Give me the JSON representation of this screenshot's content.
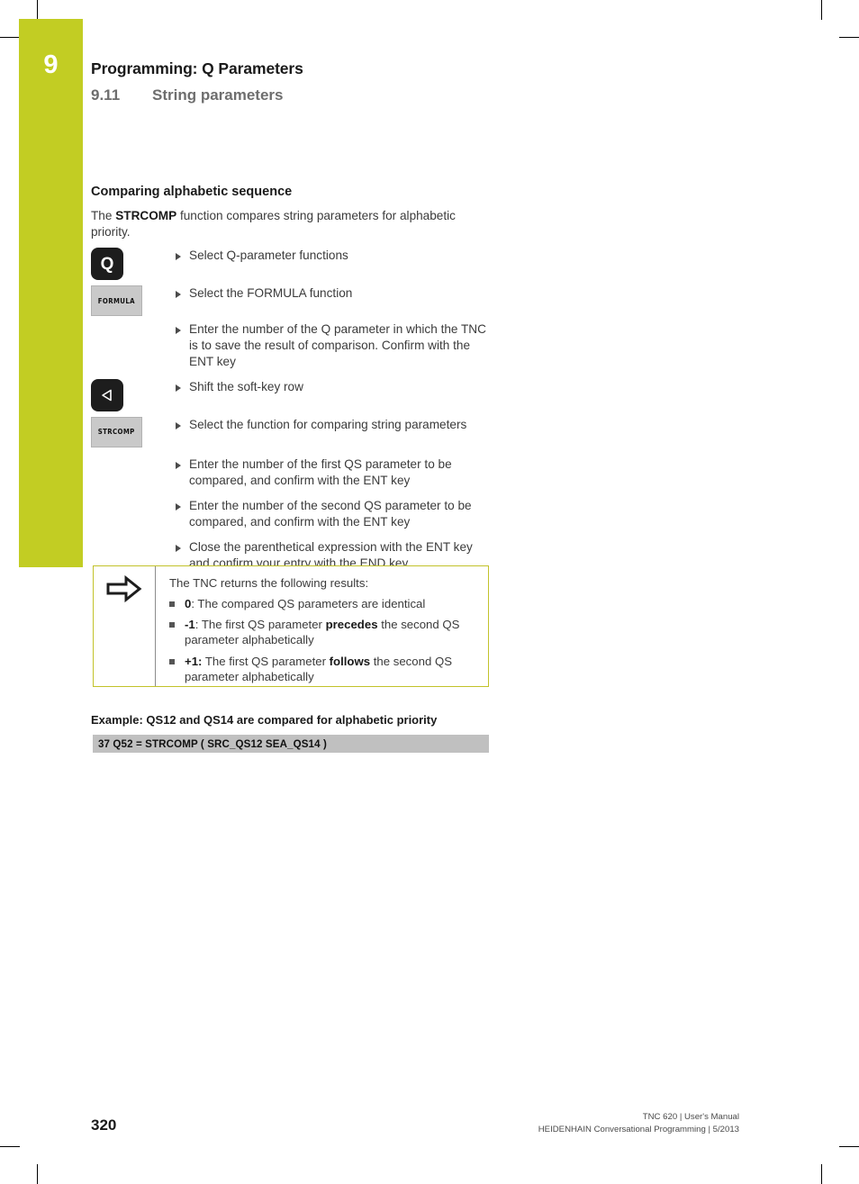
{
  "colors": {
    "chapter_tab_green": "#c2cd23",
    "note_border_yellow": "#c2c22a",
    "code_block_gray": "#c0c0c0",
    "key_black": "#1d1d1d",
    "softkey_gray": "#c9c9c9"
  },
  "chapter": {
    "number": "9",
    "title": "Programming: Q Parameters",
    "section_number": "9.11",
    "section_title": "String parameters"
  },
  "main": {
    "subheading": "Comparing alphabetic sequence",
    "intro_prefix": "The ",
    "intro_bold": "STRCOMP",
    "intro_suffix": " function compares string parameters for alphabetic priority.",
    "steps": [
      {
        "key_type": "hard",
        "key_label": "Q",
        "key_icon": "q-key",
        "text": "Select Q-parameter functions"
      },
      {
        "key_type": "soft",
        "key_label": "FORMULA",
        "key_icon": "formula-softkey",
        "text": "Select the FORMULA function"
      },
      {
        "key_type": "none",
        "key_label": "",
        "key_icon": "",
        "text": "Enter the number of the Q parameter in which the TNC is to save the result of comparison. Confirm with the ENT key"
      },
      {
        "key_type": "hard",
        "key_label": "◁",
        "key_icon": "shift-left-arrow-key",
        "text": "Shift the soft-key row"
      },
      {
        "key_type": "soft",
        "key_label": "STRCOMP",
        "key_icon": "strcomp-softkey",
        "text": "Select the function for comparing string parameters"
      },
      {
        "key_type": "none",
        "key_label": "",
        "key_icon": "",
        "text": "Enter the number of the first QS parameter to be compared, and confirm with the ENT key"
      },
      {
        "key_type": "none",
        "key_label": "",
        "key_icon": "",
        "text": "Enter the number of the second QS parameter to be compared, and confirm with the ENT key"
      },
      {
        "key_type": "none",
        "key_label": "",
        "key_icon": "",
        "text": "Close the parenthetical expression with the ENT key and confirm your entry with the END key"
      }
    ]
  },
  "note": {
    "icon": "block-arrow-right-icon",
    "lead": "The TNC returns the following results:",
    "items": [
      {
        "bold_prefix": "0",
        "text_after": ": The compared QS parameters are identical",
        "bold_mid": "",
        "text_end": ""
      },
      {
        "bold_prefix": "-1",
        "text_after": ": The first QS parameter ",
        "bold_mid": "precedes",
        "text_end": " the second QS parameter alphabetically"
      },
      {
        "bold_prefix": "+1:",
        "text_after": " The first QS parameter ",
        "bold_mid": "follows",
        "text_end": " the second QS parameter alphabetically"
      }
    ]
  },
  "example": {
    "heading": "Example: QS12 and QS14 are compared for alphabetic priority",
    "code": "37 Q52 = STRCOMP ( SRC_QS12 SEA_QS14 )"
  },
  "footer": {
    "page_number": "320",
    "line1": "TNC 620 | User's Manual",
    "line2": "HEIDENHAIN Conversational Programming | 5/2013"
  }
}
